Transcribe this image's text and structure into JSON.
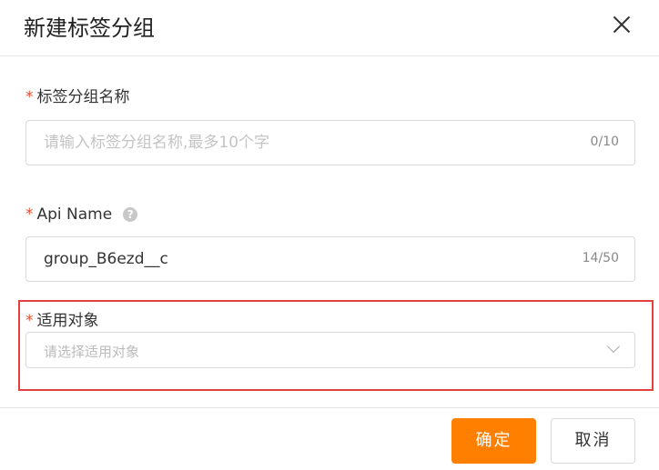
{
  "dialog": {
    "title": "新建标签分组",
    "close_icon": "close-icon"
  },
  "fields": {
    "group_name": {
      "required_mark": "*",
      "label": "标签分组名称",
      "value": "",
      "placeholder": "请输入标签分组名称,最多10个字",
      "counter": "0/10"
    },
    "api_name": {
      "required_mark": "*",
      "label": "Api Name",
      "help_icon": "help-icon",
      "help_glyph": "?",
      "value": "group_B6ezd__c",
      "counter": "14/50"
    },
    "target": {
      "required_mark": "*",
      "label": "适用对象",
      "placeholder": "请选择适用对象",
      "dropdown_icon": "chevron-down-icon"
    }
  },
  "footer": {
    "confirm_label": "确定",
    "cancel_label": "取消"
  },
  "colors": {
    "accent": "#ff8000",
    "required": "#ee4b2b",
    "highlight_border": "#e34040"
  }
}
